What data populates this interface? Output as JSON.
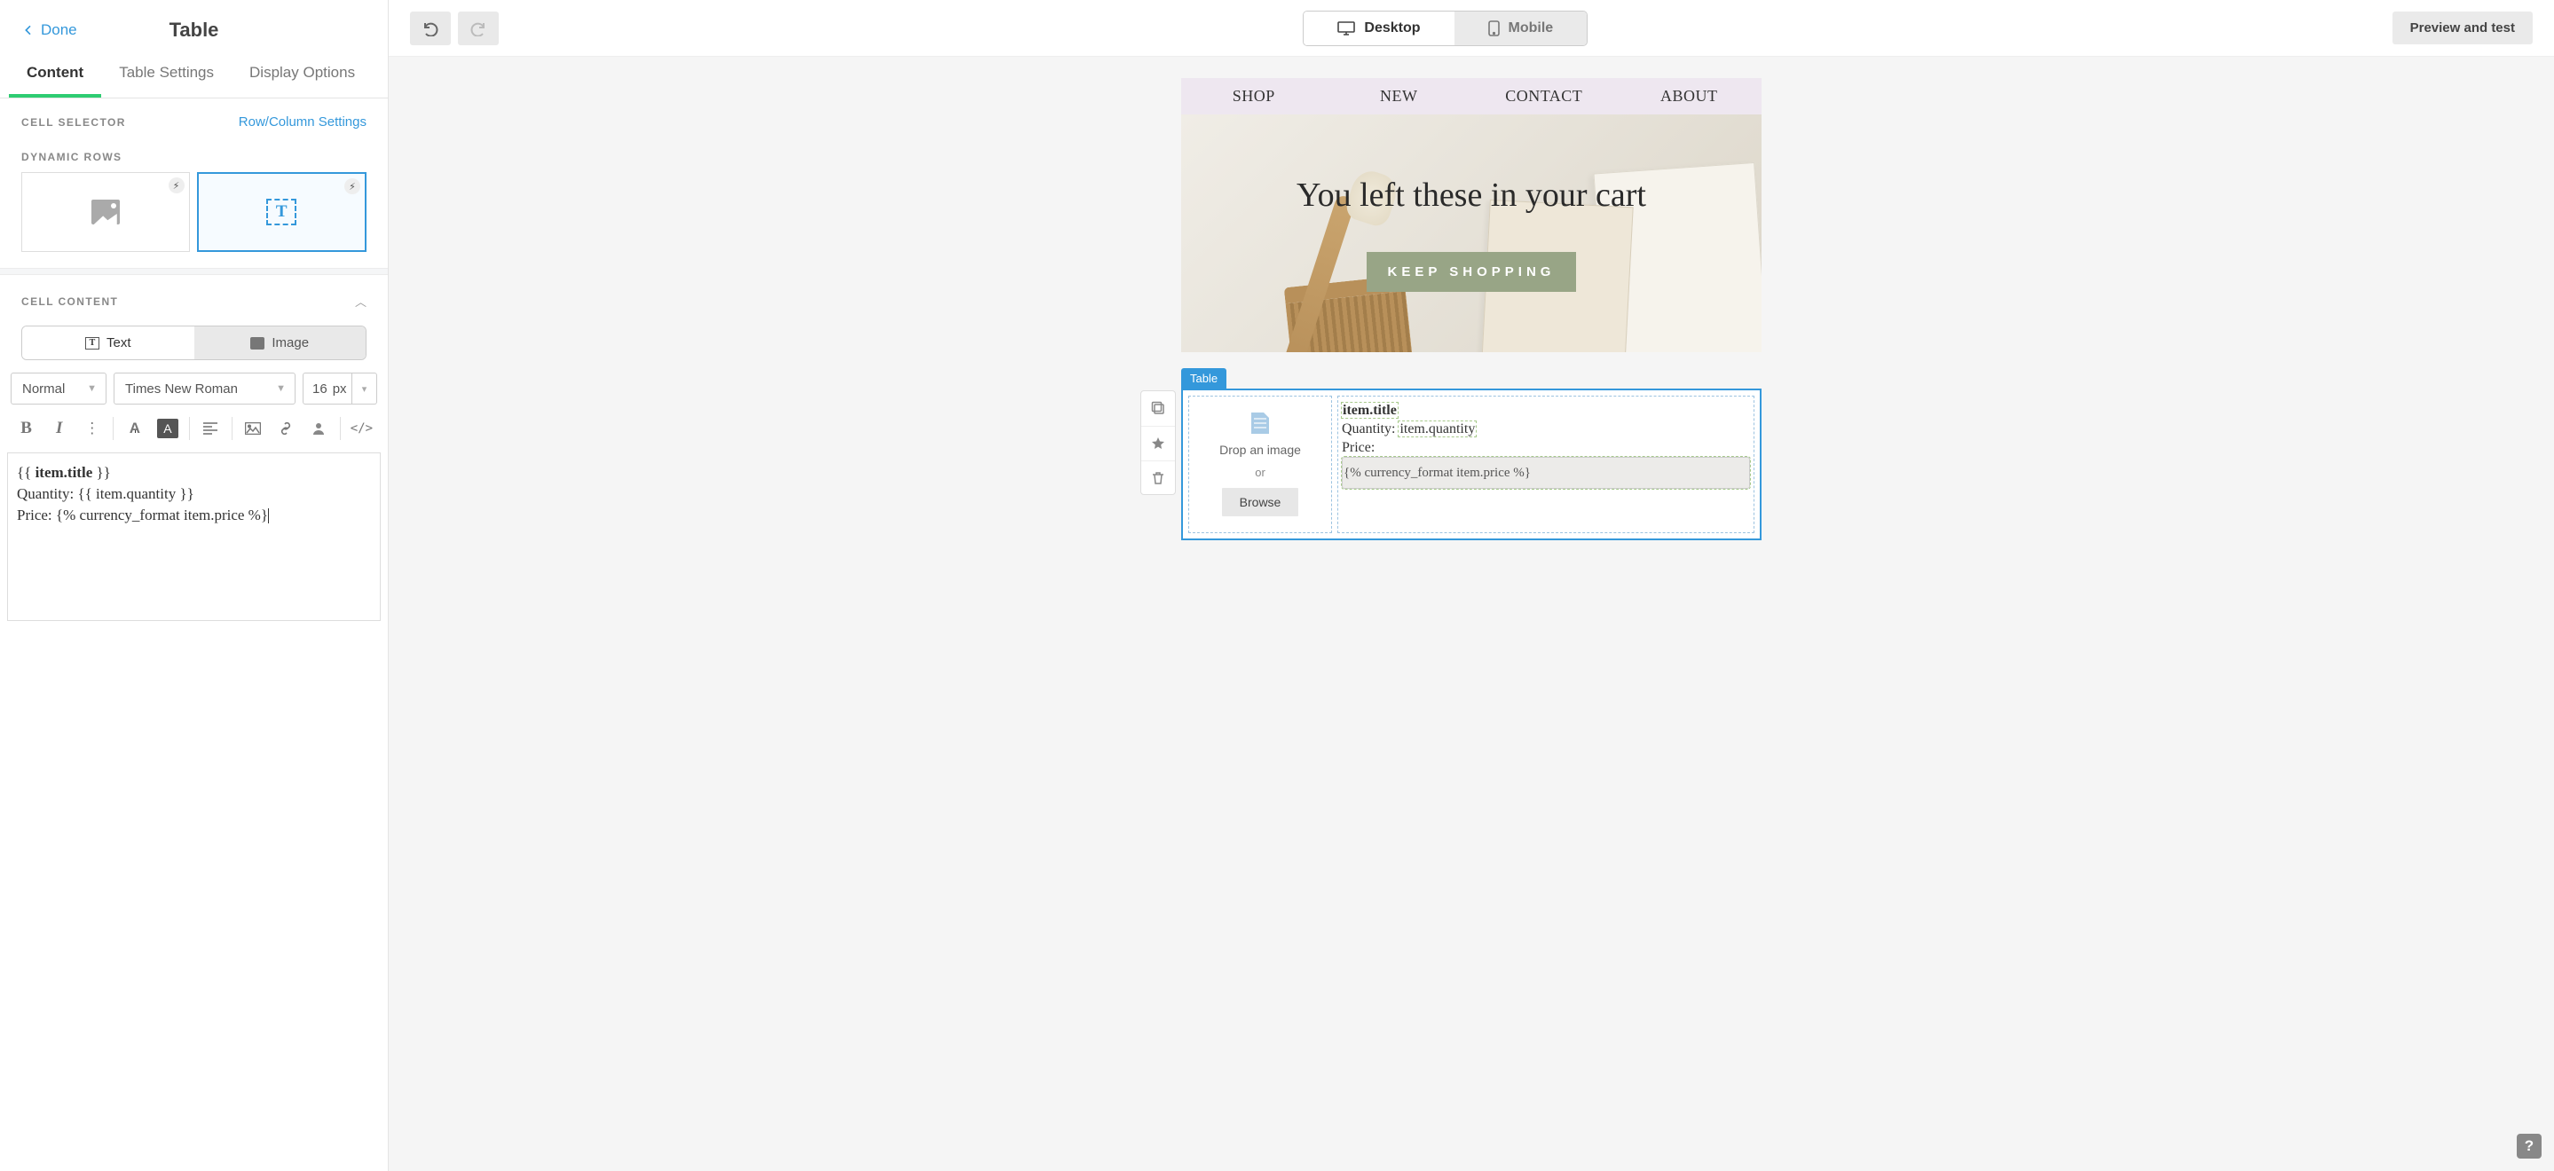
{
  "panel": {
    "done": "Done",
    "title": "Table",
    "tabs": {
      "content": "Content",
      "settings": "Table Settings",
      "display": "Display Options"
    },
    "cellSelector": {
      "label": "CELL SELECTOR",
      "link": "Row/Column Settings"
    },
    "dynamicRows": {
      "label": "DYNAMIC ROWS"
    },
    "cellContent": {
      "label": "CELL CONTENT",
      "text": "Text",
      "image": "Image",
      "styleSelect": "Normal",
      "fontSelect": "Times New Roman",
      "size": "16",
      "sizeUnit": "px"
    },
    "editor": {
      "line1_open": "{{ ",
      "line1_bold": "item.title",
      "line1_close": " }}",
      "line2": "Quantity: {{ item.quantity }}",
      "line3": "Price: {% currency_format item.price %}"
    }
  },
  "top": {
    "desktop": "Desktop",
    "mobile": "Mobile",
    "preview": "Preview and test"
  },
  "email": {
    "nav": {
      "shop": "SHOP",
      "new": "NEW",
      "contact": "CONTACT",
      "about": "ABOUT"
    },
    "heroTitle": "You left these in your cart",
    "heroBtn": "KEEP SHOPPING",
    "tableTag": "Table",
    "drop": {
      "title": "Drop an image",
      "or": "or",
      "browse": "Browse"
    },
    "cellText": {
      "title": "item.title",
      "qtyPrefix": "Quantity: ",
      "qtyTok": "item.quantity",
      "pricePrefix": "Price: ",
      "priceTok": "{% currency_format item.price %}"
    }
  },
  "help": "?"
}
